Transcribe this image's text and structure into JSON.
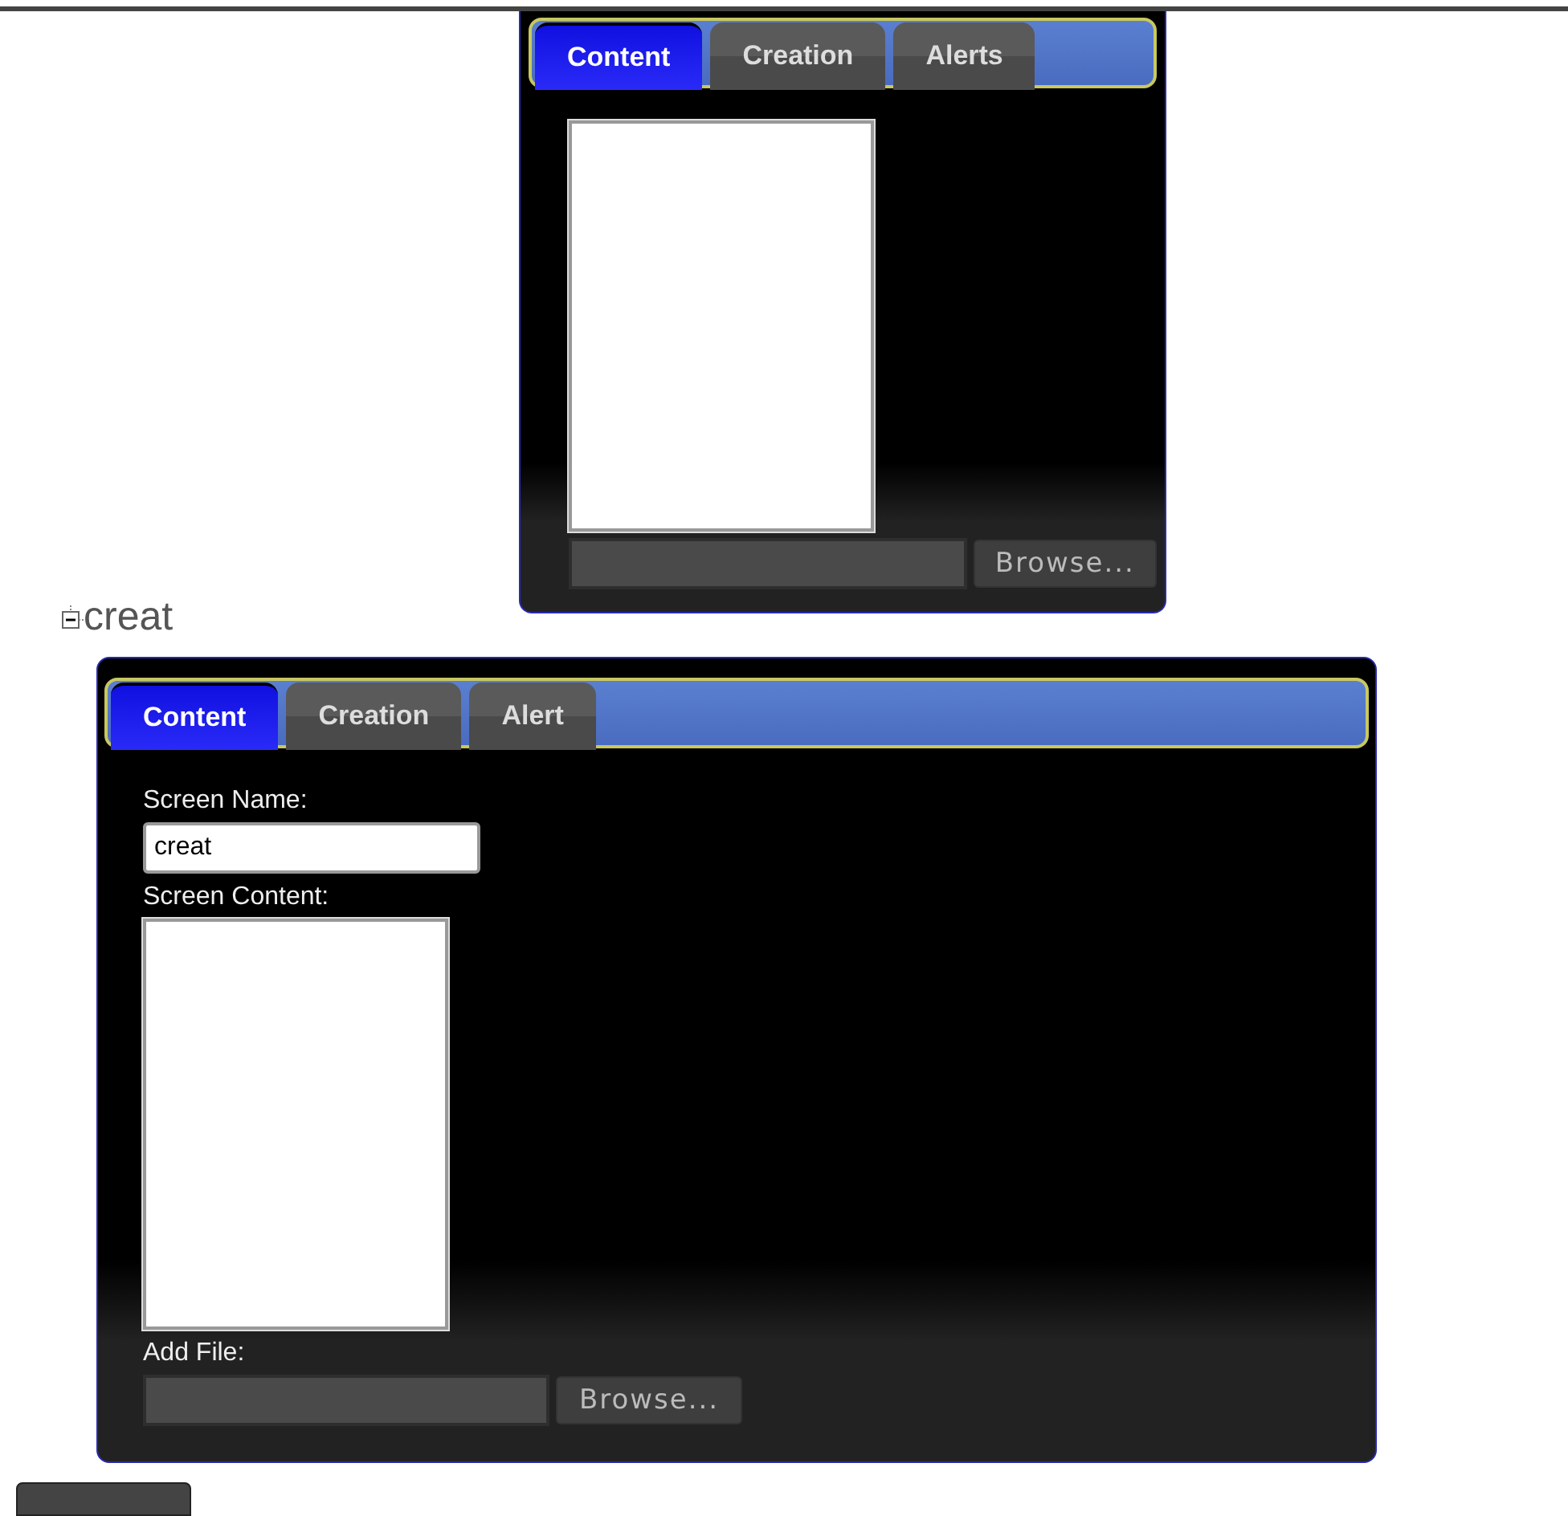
{
  "top_panel": {
    "tabs": [
      {
        "label": "Content",
        "selected": true
      },
      {
        "label": "Creation",
        "selected": false
      },
      {
        "label": "Alerts",
        "selected": false
      }
    ],
    "browse_button": "Browse..."
  },
  "tree_node": {
    "label": "creat",
    "expanded": true
  },
  "bottom_panel": {
    "tabs": [
      {
        "label": "Content",
        "selected": true
      },
      {
        "label": "Creation",
        "selected": false
      },
      {
        "label": "Alert",
        "selected": false
      }
    ],
    "screen_name_label": "Screen Name:",
    "screen_name_value": "creat",
    "screen_content_label": "Screen Content:",
    "add_file_label": "Add File:",
    "browse_button": "Browse..."
  }
}
